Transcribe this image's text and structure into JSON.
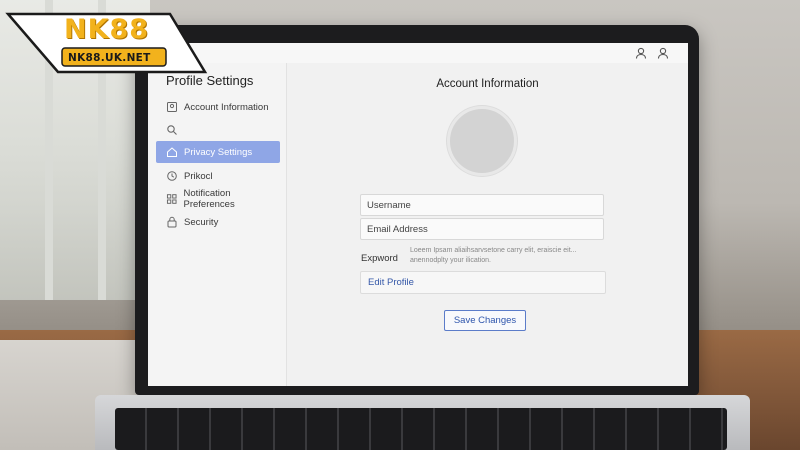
{
  "logo": {
    "brand": "NK88",
    "domain": "NK88.UK.NET"
  },
  "sidebar": {
    "title": "Profile Settings",
    "items": [
      {
        "label": "Account Information",
        "icon": "account-icon"
      },
      {
        "label": "",
        "icon": "search-icon"
      },
      {
        "label": "Privacy Settings",
        "icon": "home-icon",
        "active": true
      },
      {
        "label": "Prikocl",
        "icon": "clock-icon"
      },
      {
        "label": "Notification Preferences",
        "icon": "grid-icon"
      },
      {
        "label": "Security",
        "icon": "lock-icon"
      }
    ]
  },
  "main": {
    "title": "Account Information",
    "username_placeholder": "Username",
    "email_placeholder": "Email Address",
    "password_label": "Expword",
    "password_desc": "Loeem Ipsam aliaihsarvsetone carry elit, eraiscie eit... anennodplty your ilication.",
    "edit_profile": "Edit Profile",
    "save_changes": "Save Changes"
  },
  "colors": {
    "active": "#8fa6e6",
    "accent": "#2f56ad",
    "logo": "#f2b21c"
  }
}
